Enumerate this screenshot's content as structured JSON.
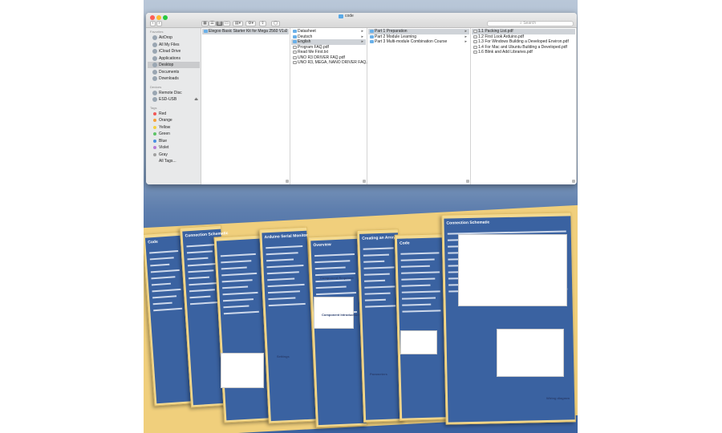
{
  "window": {
    "title": "code",
    "search_placeholder": "Search"
  },
  "sidebar": {
    "favorites_header": "Favorites",
    "favorites": [
      {
        "label": "AirDrop",
        "icon": "airdrop-icon"
      },
      {
        "label": "All My Files",
        "icon": "all-files-icon"
      },
      {
        "label": "iCloud Drive",
        "icon": "cloud-icon"
      },
      {
        "label": "Applications",
        "icon": "applications-icon"
      },
      {
        "label": "Desktop",
        "icon": "desktop-icon",
        "selected": true
      },
      {
        "label": "Documents",
        "icon": "documents-icon"
      },
      {
        "label": "Downloads",
        "icon": "downloads-icon"
      }
    ],
    "devices_header": "Devices",
    "devices": [
      {
        "label": "Remote Disc",
        "icon": "disc-icon"
      },
      {
        "label": "ESD-USB",
        "icon": "usb-drive-icon",
        "eject": "⏏"
      }
    ],
    "tags_header": "Tags",
    "tags": [
      {
        "label": "Red",
        "color": "#f25757"
      },
      {
        "label": "Orange",
        "color": "#f5a13a"
      },
      {
        "label": "Yellow",
        "color": "#f4d03f"
      },
      {
        "label": "Green",
        "color": "#5cc466"
      },
      {
        "label": "Blue",
        "color": "#4a90e2"
      },
      {
        "label": "Violet",
        "color": "#b67ad8"
      },
      {
        "label": "Gray",
        "color": "#a0a0a0"
      },
      {
        "label": "All Tags...",
        "color": ""
      }
    ]
  },
  "columns": [
    {
      "items": [
        {
          "label": "Elegoo Basic Starter Kit for Mega 2560 V1.0",
          "folder": true,
          "selected": true
        }
      ]
    },
    {
      "items": [
        {
          "label": "Datasheet",
          "folder": true
        },
        {
          "label": "Deutsch",
          "folder": true
        },
        {
          "label": "English",
          "folder": true,
          "selected": true
        },
        {
          "label": "Program FAQ.pdf",
          "folder": false
        },
        {
          "label": "Read Me First.txt",
          "folder": false
        },
        {
          "label": "UNO R3 DRIVER FAQ.pdf",
          "folder": false
        },
        {
          "label": "UNO R3, MEGA, NANO DRIVER FAQ.pdf",
          "folder": false
        }
      ]
    },
    {
      "items": [
        {
          "label": "Part 1 Preparation",
          "folder": true,
          "selected": true
        },
        {
          "label": "Part 2 Module Learning",
          "folder": true
        },
        {
          "label": "Part 3 Multi-module Combination Course",
          "folder": true
        }
      ]
    },
    {
      "items": [
        {
          "label": "1.1 Packing List.pdf",
          "folder": false,
          "selected": true
        },
        {
          "label": "1.2 First Look Arduino.pdf",
          "folder": false
        },
        {
          "label": "1.3 For Windows Building a Developed Environ.pdf",
          "folder": false
        },
        {
          "label": "1.4 For Mac and Ubuntu Building a Developed.pdf",
          "folder": false
        },
        {
          "label": "1.6 Blink and Add Libraries.pdf",
          "folder": false
        }
      ]
    }
  ],
  "colors": {
    "accent": "#3a62a1",
    "sheet": "#f3d98f",
    "selection": "#cfd3d8"
  },
  "sheets": [
    {
      "head": "Code"
    },
    {
      "head": "Connection Schematic"
    },
    {
      "head": ""
    },
    {
      "head": "Arduino Serial Monitor"
    },
    {
      "head": "Overview"
    },
    {
      "head": "Creating an Array"
    },
    {
      "head": "Code"
    },
    {
      "head": "Connection Schematic"
    }
  ],
  "sheet_notes": {
    "wiring_caption": "Wiring diagram",
    "settings": "Settings",
    "parameters": "Parameters",
    "component_required": "Component Required:",
    "component_intro": "Component Introduction"
  }
}
